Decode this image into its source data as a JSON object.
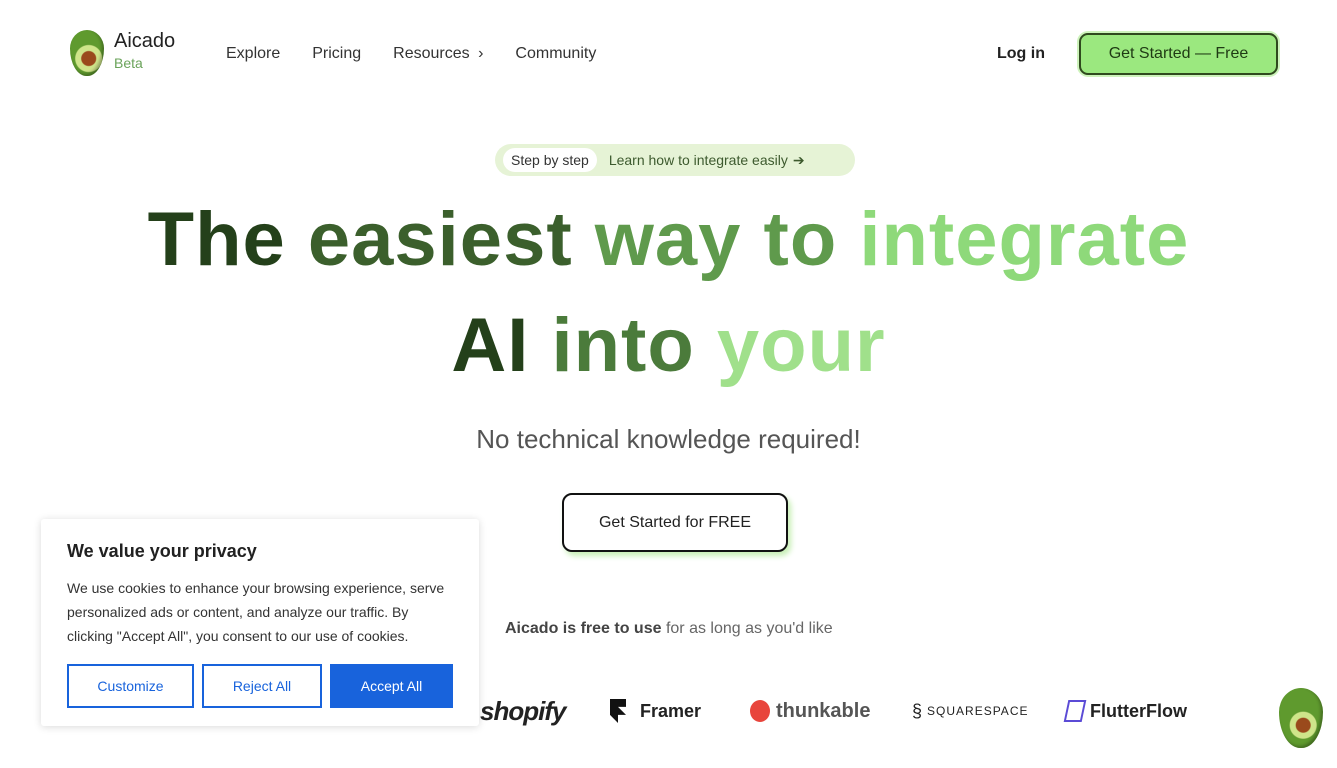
{
  "nav": {
    "brand": "Aicado",
    "badge": "Beta",
    "links": [
      "Explore",
      "Pricing",
      "Resources",
      "Community"
    ],
    "resources_chevron": "›",
    "login": "Log in",
    "cta": "Get Started — Free"
  },
  "hero": {
    "pill_tag": "Step by step",
    "pill_text": "Learn how to integrate easily",
    "pill_arrow": "➔",
    "line1": [
      {
        "t": "The",
        "c": "#24401a"
      },
      {
        "t": "easiest",
        "c": "#3b5f2c"
      },
      {
        "t": "way to",
        "c": "#5f9a4c"
      },
      {
        "t": "integrate",
        "c": "#8ed97a"
      }
    ],
    "line2": [
      {
        "t": "AI",
        "c": "#24401a"
      },
      {
        "t": "into",
        "c": "#4b7b3b"
      },
      {
        "t": "your",
        "c": "#a0e08b"
      }
    ],
    "subtitle": "No technical knowledge required!",
    "cta": "Get Started for FREE",
    "free_bold": "Aicado is free to use",
    "free_rest": " for as long as you'd like"
  },
  "partners": [
    "shopify",
    "Framer",
    "thunkable",
    "SQUARESPACE",
    "FlutterFlow"
  ],
  "cookie": {
    "title": "We value your privacy",
    "body": "We use cookies to enhance your browsing experience, serve personalized ads or content, and analyze our traffic. By clicking \"Accept All\", you consent to our use of cookies.",
    "customize": "Customize",
    "reject": "Reject All",
    "accept": "Accept All",
    "accent": "#1863dc"
  }
}
